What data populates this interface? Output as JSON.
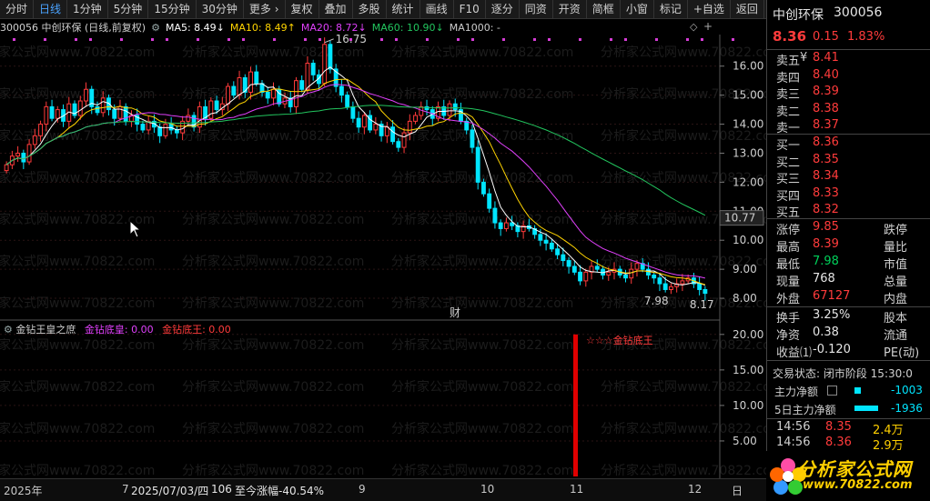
{
  "toolbar": {
    "items": [
      "分时",
      "日线",
      "1分钟",
      "5分钟",
      "15分钟",
      "30分钟",
      "更多 ›",
      "复权",
      "叠加",
      "多股",
      "统计",
      "画线",
      "F10",
      "逐分",
      "同资",
      "开资",
      "简框",
      "小窗",
      "标记",
      "+自选",
      "返回"
    ],
    "active_index": 1
  },
  "header": {
    "code_name": "300056  中创环保 (日线,前复权)",
    "ma5": "MA5: 8.49↓",
    "ma10": "MA10: 8.49↑",
    "ma20": "MA20: 8.72↓",
    "ma60": "MA60: 10.90↓",
    "ma1000": "MA1000: -"
  },
  "colors": {
    "up": "#ff3b3b",
    "down": "#00e5ff",
    "ma5": "#ffffff",
    "ma10": "#ffd400",
    "ma20": "#e040fb",
    "ma60": "#22c55e",
    "indicator_blue": "#00e5ff"
  },
  "chart_data": {
    "type": "candlestick",
    "price_axis": {
      "ticks": [
        "16.00",
        "15.00",
        "14.00",
        "13.00",
        "12.00",
        "11.00",
        "10.00",
        "9.00",
        "8.00"
      ],
      "range": [
        7.5,
        16.9
      ]
    },
    "x_axis_ticks": [
      "2025年",
      "7",
      "9",
      "10",
      "11",
      "12",
      "日"
    ],
    "high_marker": "16.75",
    "low_marker": "7.98",
    "last_marker": "8.17",
    "current_price_tag": "10.77",
    "cai_marker": "财",
    "closes": [
      12.6,
      12.9,
      13.0,
      12.7,
      13.3,
      13.6,
      14.0,
      14.6,
      14.2,
      14.5,
      14.1,
      14.7,
      14.3,
      14.8,
      15.2,
      14.6,
      14.4,
      14.9,
      14.5,
      14.2,
      14.6,
      14.1,
      14.3,
      14.0,
      13.8,
      14.1,
      13.9,
      13.6,
      14.0,
      13.8,
      13.7,
      14.1,
      14.3,
      13.9,
      14.6,
      14.2,
      14.8,
      14.5,
      14.7,
      15.3,
      15.0,
      15.6,
      15.1,
      15.8,
      15.4,
      15.1,
      14.9,
      15.2,
      14.7,
      14.9,
      14.6,
      15.5,
      15.2,
      16.1,
      15.7,
      15.4,
      16.75,
      15.9,
      15.3,
      15.0,
      14.6,
      14.2,
      13.9,
      14.3,
      13.8,
      14.0,
      13.6,
      13.9,
      13.4,
      13.2,
      13.7,
      14.1,
      14.3,
      14.6,
      14.5,
      14.2,
      14.6,
      14.3,
      14.7,
      14.5,
      14.1,
      13.8,
      13.2,
      12.0,
      11.6,
      11.1,
      10.6,
      10.4,
      10.6,
      10.5,
      10.3,
      10.5,
      10.4,
      10.2,
      10.0,
      9.9,
      9.7,
      9.5,
      9.3,
      9.1,
      8.9,
      8.6,
      8.9,
      9.1,
      9.0,
      8.8,
      8.9,
      9.0,
      8.8,
      8.7,
      9.0,
      9.2,
      9.0,
      8.8,
      8.7,
      8.5,
      8.3,
      8.4,
      8.5,
      8.6,
      8.7,
      8.5,
      8.3,
      8.17
    ],
    "indicator": {
      "title": "金钻王皇之庶",
      "label1": "金钻底皇: 0.00",
      "label2": "金钻底王: 0.00",
      "signal_label": "☆☆☆金钻底王",
      "axis_ticks": [
        "20.00",
        "15.00",
        "10.00",
        "5.00"
      ],
      "range": [
        0,
        21
      ],
      "signal_value": 20
    }
  },
  "bottom": {
    "date_info": "2025/07/03/四",
    "count": "106",
    "change": "至今涨幅-40.54%"
  },
  "panel": {
    "title": "中创环保",
    "code": "300056",
    "price": "8.36",
    "change": "0.15",
    "pct": "1.83%",
    "asks": [
      {
        "label": "卖五",
        "price": "8.41",
        "extra": "¥"
      },
      {
        "label": "卖四",
        "price": "8.40",
        "extra": ""
      },
      {
        "label": "卖三",
        "price": "8.39",
        "extra": ""
      },
      {
        "label": "卖二",
        "price": "8.38",
        "extra": ""
      },
      {
        "label": "卖一",
        "price": "8.37",
        "extra": ""
      }
    ],
    "bids": [
      {
        "label": "买一",
        "price": "8.36"
      },
      {
        "label": "买二",
        "price": "8.35"
      },
      {
        "label": "买三",
        "price": "8.34"
      },
      {
        "label": "买四",
        "price": "8.33"
      },
      {
        "label": "买五",
        "price": "8.32"
      }
    ],
    "stats": [
      {
        "l1": "涨停",
        "v": "9.85",
        "l2": "跌停",
        "c": "red"
      },
      {
        "l1": "最高",
        "v": "8.39",
        "l2": "量比",
        "c": "red"
      },
      {
        "l1": "最低",
        "v": "7.98",
        "l2": "市值",
        "c": "green"
      },
      {
        "l1": "现量",
        "v": "768",
        "l2": "总量",
        "c": "white"
      },
      {
        "l1": "外盘",
        "v": "67127",
        "l2": "内盘",
        "c": "red"
      }
    ],
    "stats2": [
      {
        "l1": "换手",
        "v": "3.25%",
        "l2": "股本",
        "c": "white"
      },
      {
        "l1": "净资",
        "v": "0.38",
        "l2": "流通",
        "c": "white"
      },
      {
        "l1": "收益⑴",
        "v": "-0.120",
        "l2": "PE(动)",
        "c": "white"
      }
    ],
    "trade_state": "交易状态: 闭市阶段 15:30:0",
    "main_flow_label": "主力净额",
    "main_flow_value": "-1003",
    "five_day_label": "5日主力净额",
    "five_day_value": "-1936",
    "ticks": [
      {
        "time": "14:56",
        "price": "8.35",
        "vol": "2.4万"
      },
      {
        "time": "14:56",
        "price": "8.36",
        "vol": "2.9万"
      }
    ],
    "logo_text": "分析家公式网",
    "logo_url": "www.70822.com"
  },
  "watermark": "分析家公式网www.70822.com"
}
